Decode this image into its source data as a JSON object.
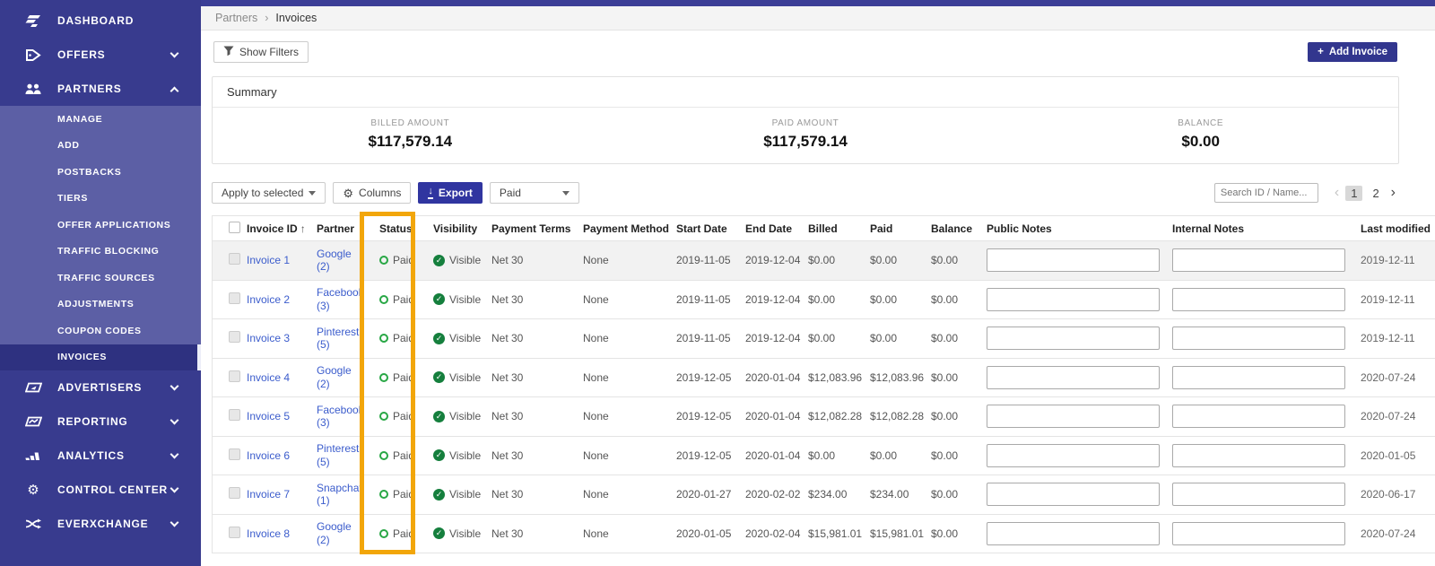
{
  "sidebar": {
    "items": [
      {
        "label": "DASHBOARD",
        "icon": "logo-icon",
        "chevron": "none"
      },
      {
        "label": "OFFERS",
        "icon": "tag-icon",
        "chevron": "down"
      },
      {
        "label": "PARTNERS",
        "icon": "people-icon",
        "chevron": "up"
      },
      {
        "label": "ADVERTISERS",
        "icon": "advertisers-icon",
        "chevron": "down"
      },
      {
        "label": "REPORTING",
        "icon": "report-chart-icon",
        "chevron": "down"
      },
      {
        "label": "ANALYTICS",
        "icon": "bar-chart-icon",
        "chevron": "down"
      },
      {
        "label": "CONTROL CENTER",
        "icon": "gear-icon",
        "chevron": "down"
      },
      {
        "label": "EVERXCHANGE",
        "icon": "shuffle-icon",
        "chevron": "down"
      }
    ],
    "partners_submenu": [
      "MANAGE",
      "ADD",
      "POSTBACKS",
      "TIERS",
      "OFFER APPLICATIONS",
      "TRAFFIC BLOCKING",
      "TRAFFIC SOURCES",
      "ADJUSTMENTS",
      "COUPON CODES",
      "INVOICES"
    ],
    "active_item": "INVOICES"
  },
  "breadcrumb": {
    "parent": "Partners",
    "separator": "›",
    "current": "Invoices"
  },
  "actions": {
    "show_filters": "Show Filters",
    "add_invoice": "Add Invoice"
  },
  "summary": {
    "title": "Summary",
    "stats": [
      {
        "label": "BILLED AMOUNT",
        "value": "$117,579.14"
      },
      {
        "label": "PAID AMOUNT",
        "value": "$117,579.14"
      },
      {
        "label": "BALANCE",
        "value": "$0.00"
      }
    ]
  },
  "toolbar": {
    "apply_to_selected": "Apply to selected",
    "columns": "Columns",
    "export": "Export",
    "status_filter": "Paid",
    "search_placeholder": "Search ID / Name...",
    "pagination": {
      "pages": [
        "1",
        "2"
      ],
      "current": "1"
    }
  },
  "table": {
    "columns": [
      "Invoice ID",
      "Partner",
      "Status",
      "Visibility",
      "Payment Terms",
      "Payment Method",
      "Start Date",
      "End Date",
      "Billed",
      "Paid",
      "Balance",
      "Public Notes",
      "Internal Notes",
      "Last modified"
    ],
    "rows": [
      {
        "id": "Invoice 1",
        "partner": "Google",
        "partner_count": "(2)",
        "status": "Paid",
        "visibility": "Visible",
        "terms": "Net 30",
        "method": "None",
        "start": "2019-11-05",
        "end": "2019-12-04",
        "billed": "$0.00",
        "paid": "$0.00",
        "balance": "$0.00",
        "modified": "2019-12-11",
        "highlighted": true
      },
      {
        "id": "Invoice 2",
        "partner": "Facebook",
        "partner_count": "(3)",
        "status": "Paid",
        "visibility": "Visible",
        "terms": "Net 30",
        "method": "None",
        "start": "2019-11-05",
        "end": "2019-12-04",
        "billed": "$0.00",
        "paid": "$0.00",
        "balance": "$0.00",
        "modified": "2019-12-11"
      },
      {
        "id": "Invoice 3",
        "partner": "Pinterest",
        "partner_count": "(5)",
        "status": "Paid",
        "visibility": "Visible",
        "terms": "Net 30",
        "method": "None",
        "start": "2019-11-05",
        "end": "2019-12-04",
        "billed": "$0.00",
        "paid": "$0.00",
        "balance": "$0.00",
        "modified": "2019-12-11"
      },
      {
        "id": "Invoice 4",
        "partner": "Google",
        "partner_count": "(2)",
        "status": "Paid",
        "visibility": "Visible",
        "terms": "Net 30",
        "method": "None",
        "start": "2019-12-05",
        "end": "2020-01-04",
        "billed": "$12,083.96",
        "paid": "$12,083.96",
        "balance": "$0.00",
        "modified": "2020-07-24"
      },
      {
        "id": "Invoice 5",
        "partner": "Facebook",
        "partner_count": "(3)",
        "status": "Paid",
        "visibility": "Visible",
        "terms": "Net 30",
        "method": "None",
        "start": "2019-12-05",
        "end": "2020-01-04",
        "billed": "$12,082.28",
        "paid": "$12,082.28",
        "balance": "$0.00",
        "modified": "2020-07-24"
      },
      {
        "id": "Invoice 6",
        "partner": "Pinterest",
        "partner_count": "(5)",
        "status": "Paid",
        "visibility": "Visible",
        "terms": "Net 30",
        "method": "None",
        "start": "2019-12-05",
        "end": "2020-01-04",
        "billed": "$0.00",
        "paid": "$0.00",
        "balance": "$0.00",
        "modified": "2020-01-05"
      },
      {
        "id": "Invoice 7",
        "partner": "Snapchat",
        "partner_count": "(1)",
        "status": "Paid",
        "visibility": "Visible",
        "terms": "Net 30",
        "method": "None",
        "start": "2020-01-27",
        "end": "2020-02-02",
        "billed": "$234.00",
        "paid": "$234.00",
        "balance": "$0.00",
        "modified": "2020-06-17"
      },
      {
        "id": "Invoice 8",
        "partner": "Google",
        "partner_count": "(2)",
        "status": "Paid",
        "visibility": "Visible",
        "terms": "Net 30",
        "method": "None",
        "start": "2020-01-05",
        "end": "2020-02-04",
        "billed": "$15,981.01",
        "paid": "$15,981.01",
        "balance": "$0.00",
        "modified": "2020-07-24"
      }
    ]
  },
  "annotation": {
    "highlighted_column": "Status",
    "color": "#F2A60A"
  },
  "icons": {
    "sort_asc": "↑",
    "check": "✓",
    "gear": "⚙",
    "download_arrow": "↓",
    "plus": "+",
    "pag_prev": "‹",
    "pag_next": "›"
  },
  "colors": {
    "sidebar": "#383B8E",
    "sidebar_submenu": "#5C5FA5",
    "sidebar_active": "#2E3180",
    "primary_button": "#32368E",
    "link": "#3B5CCC",
    "paid_green": "#28A745",
    "visible_green": "#157F3D",
    "annotation_orange": "#F2A60A"
  }
}
